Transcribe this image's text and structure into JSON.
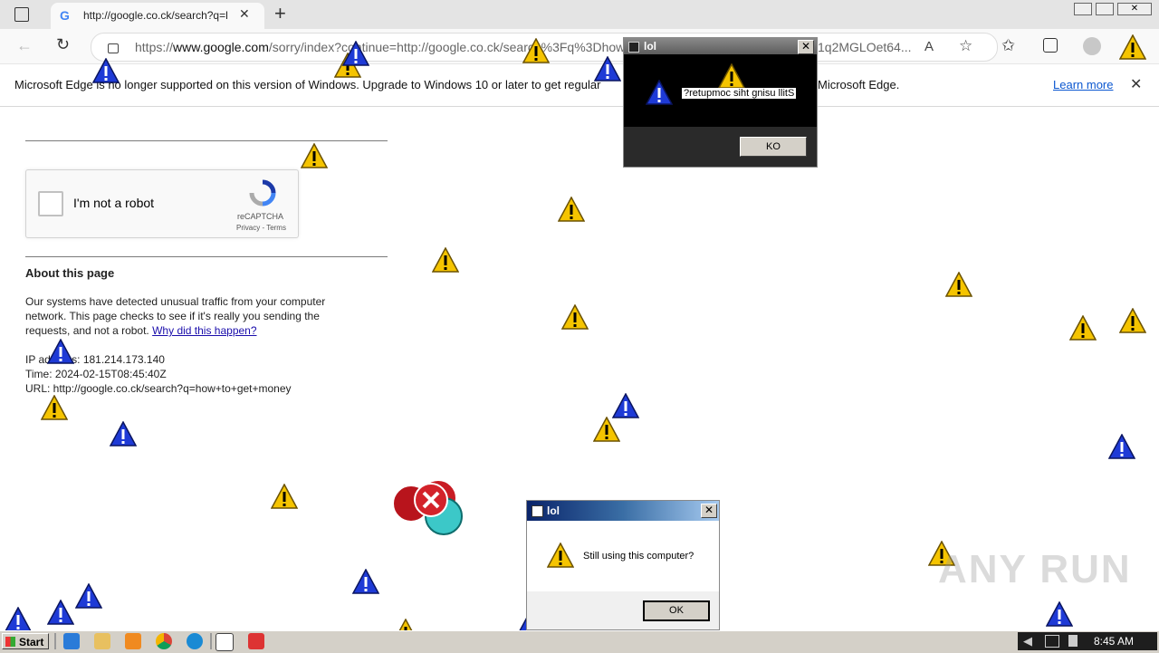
{
  "browser": {
    "tab_title": "http://google.co.ck/search?q=l",
    "url_scheme": "https://",
    "url_host": "www.google.com",
    "url_rest": "/sorry/index?continue=http://google.co.ck/search%3Fq%3Dhow",
    "url_tail": "1q2MGLOet64...",
    "read_aloud_label": "A"
  },
  "infobar": {
    "message": "Microsoft Edge is no longer supported on this version of Windows. Upgrade to Windows 10 or later to get regular",
    "message_tail": "Microsoft Edge.",
    "learn_more": "Learn more"
  },
  "page": {
    "captcha_label": "I'm not a robot",
    "captcha_brand": "reCAPTCHA",
    "captcha_links": "Privacy - Terms",
    "about_heading": "About this page",
    "para_line1": "Our systems have detected unusual traffic from your computer",
    "para_line2": "network. This page checks to see if it's really you sending the",
    "para_line3": "requests, and not a robot.",
    "why_link": "Why did this happen?",
    "ip_label": "IP address:",
    "ip_value": "181.214.173.140",
    "time_line": "Time: 2024-02-15T08:45:40Z",
    "url_line": "URL: http://google.co.ck/search?q=how+to+get+money"
  },
  "dialog_black": {
    "title": "lol",
    "message": "?retupmoc siht gnisu llitS",
    "ok_label": "KO"
  },
  "dialog_white": {
    "title": "lol",
    "message": "Still using this computer?",
    "ok_label": "OK"
  },
  "taskbar": {
    "start_label": "Start",
    "clock": "8:45 AM"
  },
  "watermark": "ANY RUN",
  "colors": {
    "warning_yellow": "#f5c400",
    "warning_blue": "#1e3ad6",
    "error_red": "#d3222a",
    "link_blue": "#1a0dab"
  }
}
